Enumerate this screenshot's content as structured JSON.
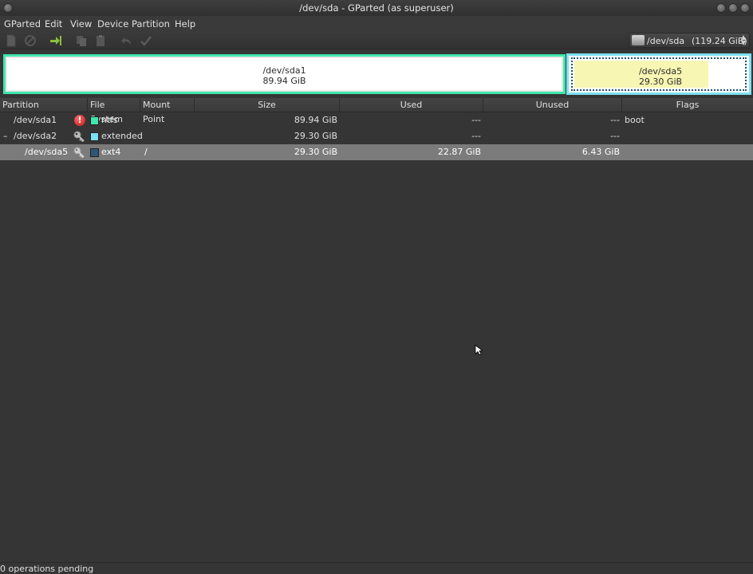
{
  "window": {
    "title": "/dev/sda - GParted (as superuser)"
  },
  "menubar": {
    "items": [
      "GParted",
      "Edit",
      "View",
      "Device",
      "Partition",
      "Help"
    ]
  },
  "toolbar": {
    "icons": [
      "new-partition-icon",
      "delete-icon",
      "resize-move-icon",
      "copy-icon",
      "paste-icon",
      "undo-icon",
      "apply-icon"
    ]
  },
  "device": {
    "name": "/dev/sda",
    "size": "(119.24 GiB)"
  },
  "diskmap": {
    "sda1": {
      "name": "/dev/sda1",
      "size": "89.94 GiB",
      "color": "#42e5ac"
    },
    "sda5": {
      "name": "/dev/sda5",
      "size": "29.30 GiB",
      "border_color": "#7de0f2",
      "used_fraction": 0.78
    }
  },
  "table": {
    "headers": [
      "Partition",
      "File System",
      "Mount Point",
      "Size",
      "Used",
      "Unused",
      "Flags"
    ],
    "rows": [
      {
        "partition": "/dev/sda1",
        "expander": "",
        "status_icon": "warning-icon",
        "fs_color": "#42e5ac",
        "fs": "ntfs",
        "mount": "",
        "size": "89.94 GiB",
        "used": "---",
        "unused": "---",
        "flags": "boot"
      },
      {
        "partition": "/dev/sda2",
        "expander": "–",
        "status_icon": "key-icon",
        "fs_color": "#7de0f2",
        "fs": "extended",
        "mount": "",
        "size": "29.30 GiB",
        "used": "---",
        "unused": "---",
        "flags": ""
      },
      {
        "partition": "/dev/sda5",
        "expander": "",
        "status_icon": "key-icon",
        "fs_color": "#2e5676",
        "fs": "ext4",
        "mount": "/",
        "size": "29.30 GiB",
        "used": "22.87 GiB",
        "unused": "6.43 GiB",
        "flags": ""
      }
    ]
  },
  "status": {
    "text": "0 operations pending"
  }
}
